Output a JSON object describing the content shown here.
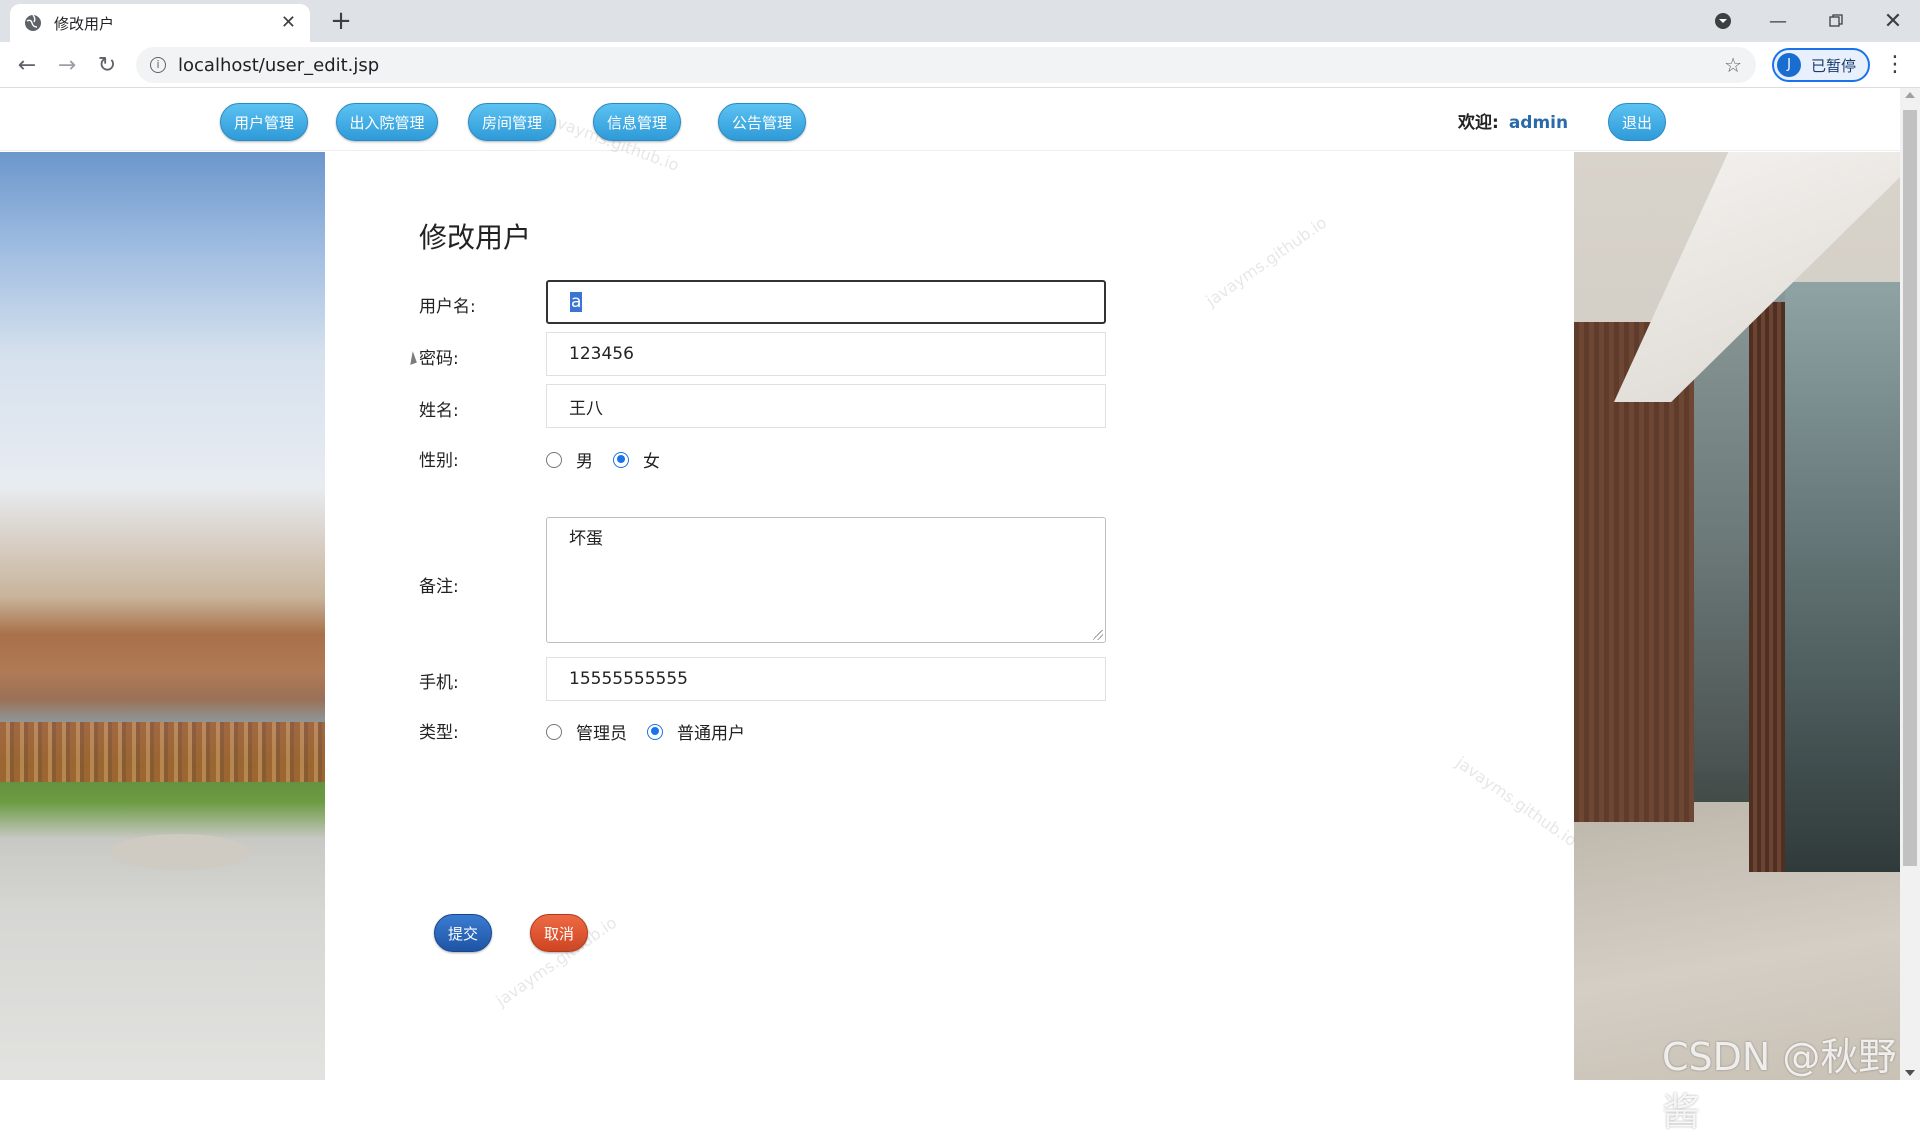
{
  "browser": {
    "tab_title": "修改用户",
    "url": "localhost/user_edit.jsp",
    "profile_initial": "J",
    "profile_label": "已暂停"
  },
  "nav": {
    "items": [
      {
        "label": "用户管理"
      },
      {
        "label": "出入院管理"
      },
      {
        "label": "房间管理"
      },
      {
        "label": "信息管理"
      },
      {
        "label": "公告管理"
      }
    ],
    "welcome_label": "欢迎:",
    "username": "admin",
    "logout_label": "退出"
  },
  "form": {
    "title": "修改用户",
    "username": {
      "label": "用户名:",
      "value": "a"
    },
    "password": {
      "label": "密码:",
      "value": "123456"
    },
    "name": {
      "label": "姓名:",
      "value": "王八"
    },
    "gender": {
      "label": "性别:",
      "options": [
        "男",
        "女"
      ],
      "selected": "女"
    },
    "remark": {
      "label": "备注:",
      "value": "坏蛋"
    },
    "phone": {
      "label": "手机:",
      "value": "15555555555"
    },
    "type": {
      "label": "类型:",
      "options": [
        "管理员",
        "普通用户"
      ],
      "selected": "普通用户"
    },
    "submit_label": "提交",
    "cancel_label": "取消"
  },
  "watermark_text": "javayms.github.io",
  "credit": "CSDN @秋野酱",
  "colors": {
    "nav_pill": "#3aa8e4",
    "submit": "#2a64b8",
    "cancel": "#e05530",
    "radio_selected": "#1a73e8"
  }
}
